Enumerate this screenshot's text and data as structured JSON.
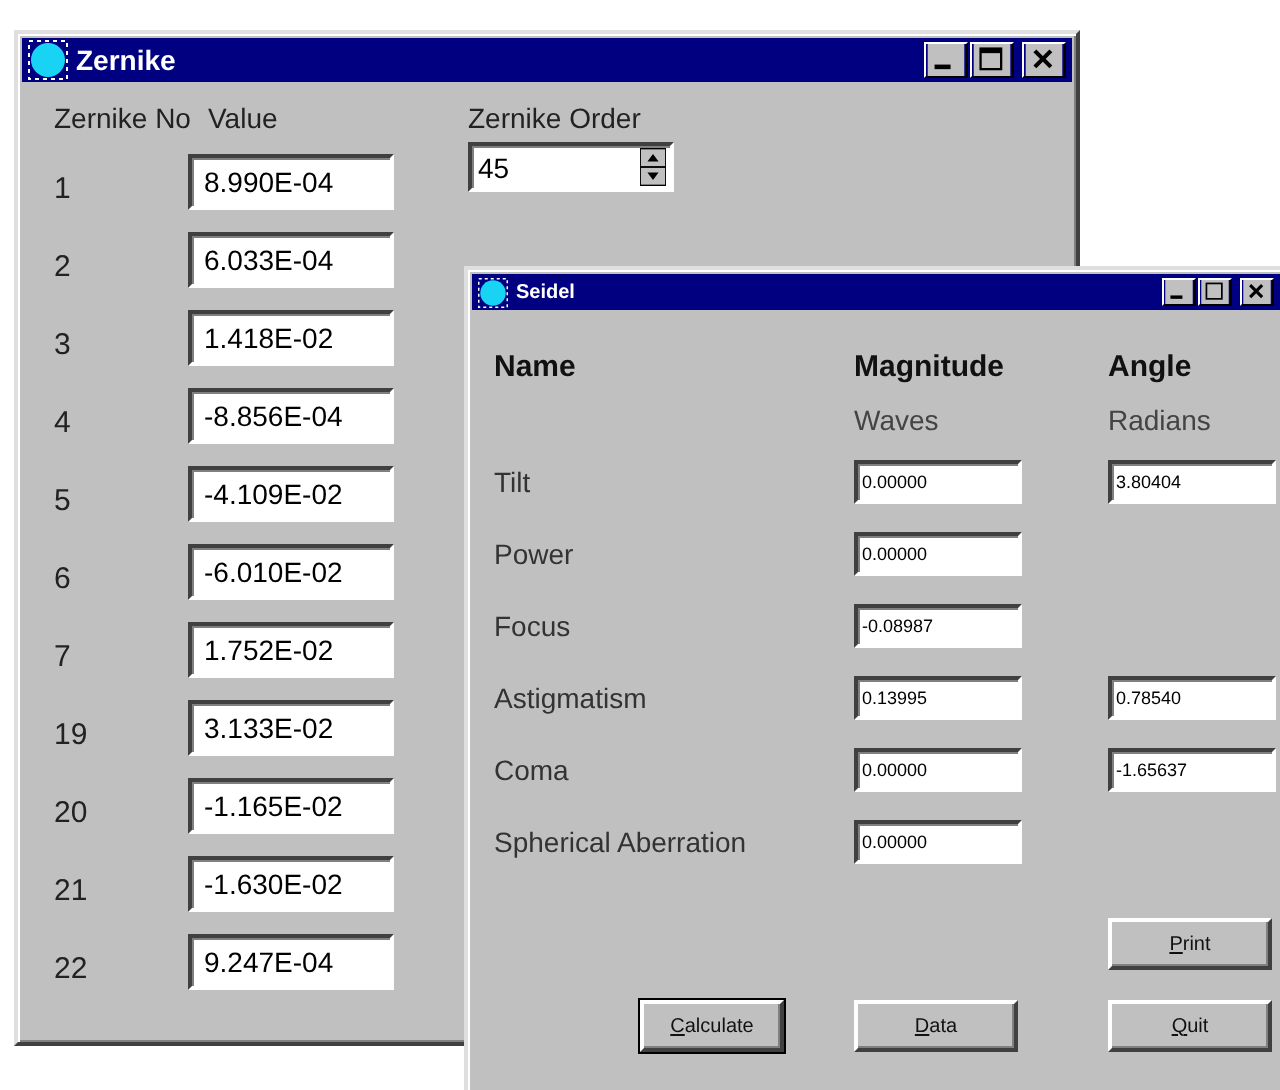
{
  "zernike_window": {
    "title": "Zernike",
    "columns": [
      "Zernike No",
      "Value"
    ],
    "rows": [
      {
        "no": "1",
        "value": "8.990E-04"
      },
      {
        "no": "2",
        "value": "6.033E-04"
      },
      {
        "no": "3",
        "value": "1.418E-02"
      },
      {
        "no": "4",
        "value": "-8.856E-04"
      },
      {
        "no": "5",
        "value": "-4.109E-02"
      },
      {
        "no": "6",
        "value": "-6.010E-02"
      },
      {
        "no": "7",
        "value": "1.752E-02"
      },
      {
        "no": "19",
        "value": "3.133E-02"
      },
      {
        "no": "20",
        "value": "-1.165E-02"
      },
      {
        "no": "21",
        "value": "-1.630E-02"
      },
      {
        "no": "22",
        "value": "9.247E-04"
      }
    ],
    "order": {
      "label": "Zernike Order",
      "value": "45"
    }
  },
  "seidel_window": {
    "title": "Seidel",
    "headers": [
      {
        "title": "Name"
      },
      {
        "title": "Magnitude",
        "unit": "Waves"
      },
      {
        "title": "Angle",
        "unit": "Radians"
      }
    ],
    "rows": [
      {
        "name": "Tilt",
        "magnitude": "0.00000",
        "angle": "3.80404"
      },
      {
        "name": "Power",
        "magnitude": "0.00000"
      },
      {
        "name": "Focus",
        "magnitude": "-0.08987"
      },
      {
        "name": "Astigmatism",
        "magnitude": "0.13995",
        "angle": "0.78540"
      },
      {
        "name": "Coma",
        "magnitude": "0.00000",
        "angle": "-1.65637"
      },
      {
        "name": "Spherical Aberration",
        "magnitude": "0.00000"
      }
    ],
    "print_button": {
      "label": "Print",
      "default": false
    },
    "buttons": [
      {
        "label": "Calculate",
        "default": true
      },
      {
        "label": "Data",
        "default": false
      },
      {
        "label": "Quit",
        "default": false
      }
    ]
  }
}
